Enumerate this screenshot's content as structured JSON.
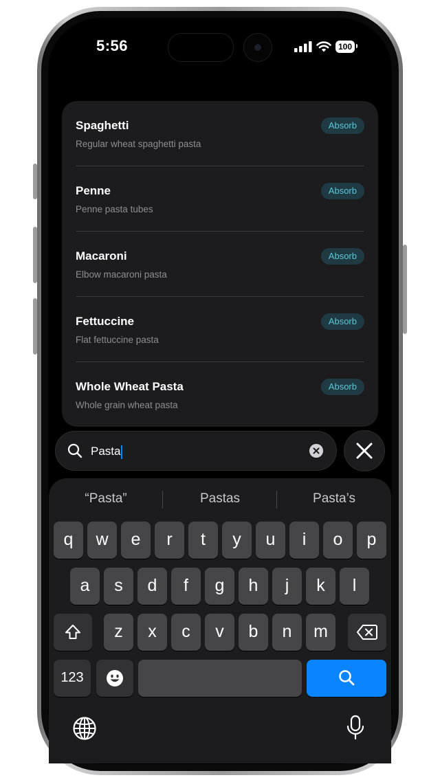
{
  "status_bar": {
    "time": "5:56",
    "battery": "100"
  },
  "list": {
    "items": [
      {
        "name": "Spaghetti",
        "description": "Regular wheat spaghetti pasta",
        "action": "Absorb"
      },
      {
        "name": "Penne",
        "description": "Penne pasta tubes",
        "action": "Absorb"
      },
      {
        "name": "Macaroni",
        "description": "Elbow macaroni pasta",
        "action": "Absorb"
      },
      {
        "name": "Fettuccine",
        "description": "Flat fettuccine pasta",
        "action": "Absorb"
      },
      {
        "name": "Whole Wheat Pasta",
        "description": "Whole grain wheat pasta",
        "action": "Absorb"
      }
    ]
  },
  "search": {
    "value": "Pasta",
    "icon": "search-icon",
    "clear_icon": "clear-icon"
  },
  "cancel": {
    "icon": "close-icon"
  },
  "keyboard": {
    "suggestions": [
      "“Pasta”",
      "Pastas",
      "Pasta’s"
    ],
    "row1": [
      "q",
      "w",
      "e",
      "r",
      "t",
      "y",
      "u",
      "i",
      "o",
      "p"
    ],
    "row2": [
      "a",
      "s",
      "d",
      "f",
      "g",
      "h",
      "j",
      "k",
      "l"
    ],
    "row3": [
      "z",
      "x",
      "c",
      "v",
      "b",
      "n",
      "m"
    ],
    "numbers_label": "123",
    "icons": {
      "shift": "shift-icon",
      "delete": "delete-icon",
      "emoji": "emoji-icon",
      "search": "search-icon",
      "globe": "globe-icon",
      "mic": "microphone-icon"
    }
  },
  "colors": {
    "accent": "#0a84ff",
    "absorb_text": "#5ac8d8",
    "absorb_bg": "#1f3a42"
  }
}
